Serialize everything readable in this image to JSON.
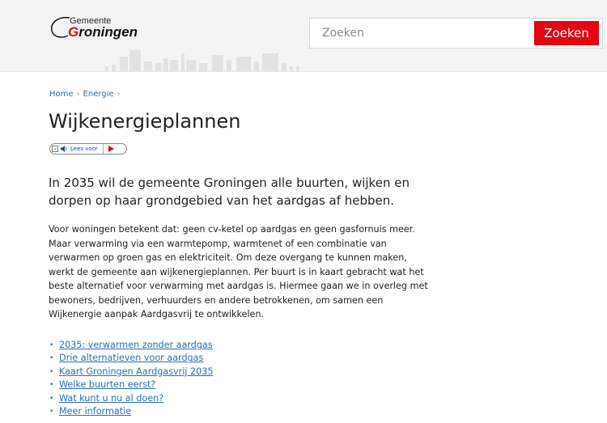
{
  "header": {
    "logo_small": "Gemeente",
    "logo_big_g": "G",
    "logo_big_rest": "roningen",
    "search_placeholder": "Zoeken",
    "search_button": "Zoeken",
    "brand_color": "#e30613"
  },
  "breadcrumb": [
    {
      "label": "Home"
    },
    {
      "label": "Energie"
    }
  ],
  "page_title": "Wijkenergieplannen",
  "readspeaker": {
    "label": "Lees voor",
    "menu_icon": "dropdown-menu-icon",
    "speaker_icon": "speaker-icon",
    "play_icon": "play-icon"
  },
  "intro": "In 2035 wil de gemeente Groningen alle buurten, wijken en dorpen op haar grondgebied van het aardgas af hebben.",
  "body": "Voor woningen betekent dat: geen cv-ketel op aardgas en geen gasfornuis meer. Maar verwarming via een warmtepomp, warmtenet of een combinatie van verwarmen op groen gas en elektriciteit. Om deze overgang te kunnen maken, werkt de gemeente aan wijkenergieplannen. Per buurt is in kaart gebracht wat het beste alternatief voor verwarming met aardgas is. Hiermee gaan we in overleg met bewoners, bedrijven, verhuurders en andere betrokkenen, om samen een Wijkenergie aanpak Aardgasvrij te ontwikkelen.",
  "links": [
    {
      "label": "2035: verwarmen zonder aardgas"
    },
    {
      "label": "Drie alternatieven voor aardgas"
    },
    {
      "label": "Kaart Groningen Aardgasvrij 2035"
    },
    {
      "label": "Welke buurten eerst?"
    },
    {
      "label": "Wat kunt u nu al doen?"
    },
    {
      "label": "Meer informatie"
    }
  ]
}
